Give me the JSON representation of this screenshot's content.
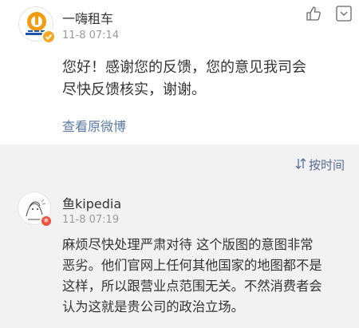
{
  "reply_card": {
    "account_name": "一嗨租车",
    "timestamp": "11-8 07:14",
    "message_line1": "您好！感谢您的反馈，您的意见我司会",
    "message_line2": "尽快反馈核实，谢谢。",
    "view_original_label": "查看原微博",
    "like_icon": "thumbs-up-icon",
    "more_icon": "chevron-down-icon",
    "logo_text": "一嗨租车"
  },
  "report_bar": {
    "label": "按时间",
    "icon": "sort-icon"
  },
  "comment": {
    "user_name": "鱼kipedia",
    "timestamp": "11-8 07:19",
    "text_line1": "麻烦尽快处理严肃对待 这个版图的意图非常",
    "text_line2": "恶劣。他们官网上任何其他国家的地图都不是",
    "text_line3": "这样，所以跟营业点范围无关。不然消费者会",
    "text_line4": "认为这就是贵公司的政治立场。",
    "like_icon": "thumbs-up-icon",
    "more_icon": "chevron-down-icon"
  },
  "colors": {
    "link": "#5b7aa6",
    "brand_orange": "#f39c12",
    "badge_red": "#e8553e"
  }
}
